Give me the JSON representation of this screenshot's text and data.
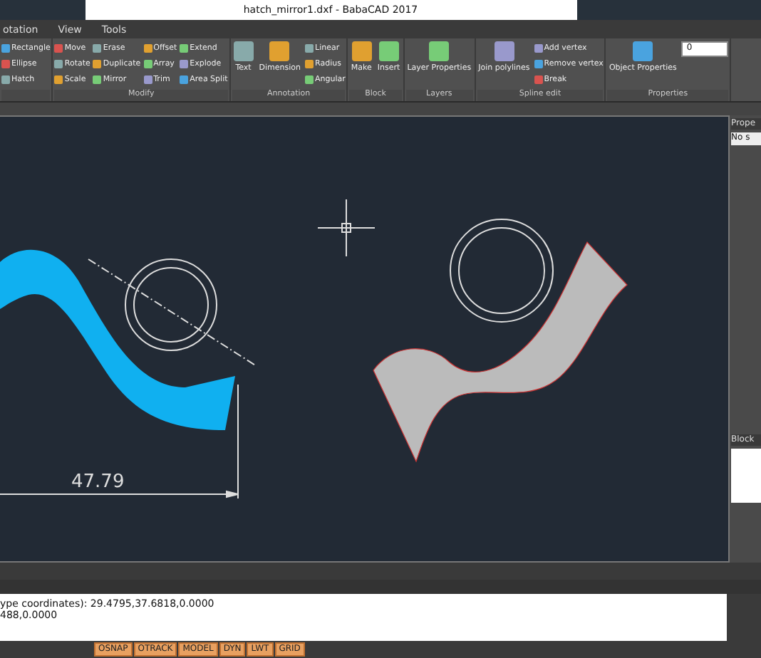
{
  "window": {
    "title": "hatch_mirror1.dxf - BabaCAD 2017"
  },
  "menu": [
    "otation",
    "View",
    "Tools"
  ],
  "ribbon": [
    {
      "columns": [
        [
          {
            "label": "Rectangle"
          },
          {
            "label": "Ellipse"
          },
          {
            "label": "Hatch"
          }
        ]
      ]
    },
    {
      "label": "Modify",
      "columns": [
        [
          {
            "label": "Move"
          },
          {
            "label": "Rotate"
          },
          {
            "label": "Scale"
          }
        ],
        [
          {
            "label": "Erase"
          },
          {
            "label": "Duplicate"
          },
          {
            "label": "Mirror"
          }
        ],
        [
          {
            "label": "Offset"
          },
          {
            "label": "Array"
          },
          {
            "label": "Trim"
          }
        ],
        [
          {
            "label": "Extend"
          },
          {
            "label": "Explode"
          },
          {
            "label": "Area Split"
          }
        ]
      ]
    },
    {
      "label": "Annotation",
      "large": [
        "Text",
        "Dimension"
      ],
      "columns": [
        [
          {
            "label": "Linear"
          },
          {
            "label": "Radius"
          },
          {
            "label": "Angular"
          }
        ]
      ]
    },
    {
      "label": "Block",
      "large": [
        "Make",
        "Insert"
      ]
    },
    {
      "label": "Layers",
      "large": [
        "Layer Properties"
      ]
    },
    {
      "label": "Spline edit",
      "large": [
        "Join polylines"
      ],
      "columns": [
        [
          {
            "label": "Add vertex"
          },
          {
            "label": "Remove vertex"
          },
          {
            "label": "Break"
          }
        ]
      ]
    },
    {
      "label": "Properties",
      "large": [
        "Object Properties"
      ],
      "layer_value": "0"
    }
  ],
  "canvas": {
    "dimension": "47.79"
  },
  "side_panel": {
    "title": "Prope",
    "field": "No s",
    "block_title": "Block"
  },
  "command": {
    "lines": [
      "ype coordinates): 29.4795,37.6818,0.0000",
      "488,0.0000"
    ]
  },
  "status_bar": [
    "OSNAP",
    "OTRACK",
    "MODEL",
    "DYN",
    "LWT",
    "GRID"
  ]
}
